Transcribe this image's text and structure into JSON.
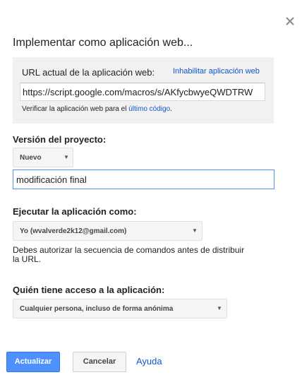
{
  "dialog": {
    "title": "Implementar como aplicación web...",
    "close_icon": "close-icon"
  },
  "url_section": {
    "label": "URL actual de la aplicación web:",
    "disable_link": "Inhabilitar aplicación web",
    "url_value": "https://script.google.com/macros/s/AKfycbwyeQWDTRW",
    "verify_prefix": "Verificar la aplicación web para el",
    "verify_link": "último código",
    "verify_suffix": "."
  },
  "version": {
    "label": "Versión del proyecto:",
    "selected": "Nuevo",
    "description_value": "modificación final"
  },
  "execute_as": {
    "label": "Ejecutar la aplicación como:",
    "selected": "Yo (wvalverde2k12@gmail.com)",
    "note": "Debes autorizar la secuencia de comandos antes de distribuir la URL."
  },
  "access": {
    "label": "Quién tiene acceso a la aplicación:",
    "selected": "Cualquier persona, incluso de forma anónima"
  },
  "buttons": {
    "update": "Actualizar",
    "cancel": "Cancelar",
    "help": "Ayuda"
  },
  "colors": {
    "primary_button": "#4d90fe",
    "link": "#1155cc",
    "panel_background": "#f1f1f1"
  }
}
